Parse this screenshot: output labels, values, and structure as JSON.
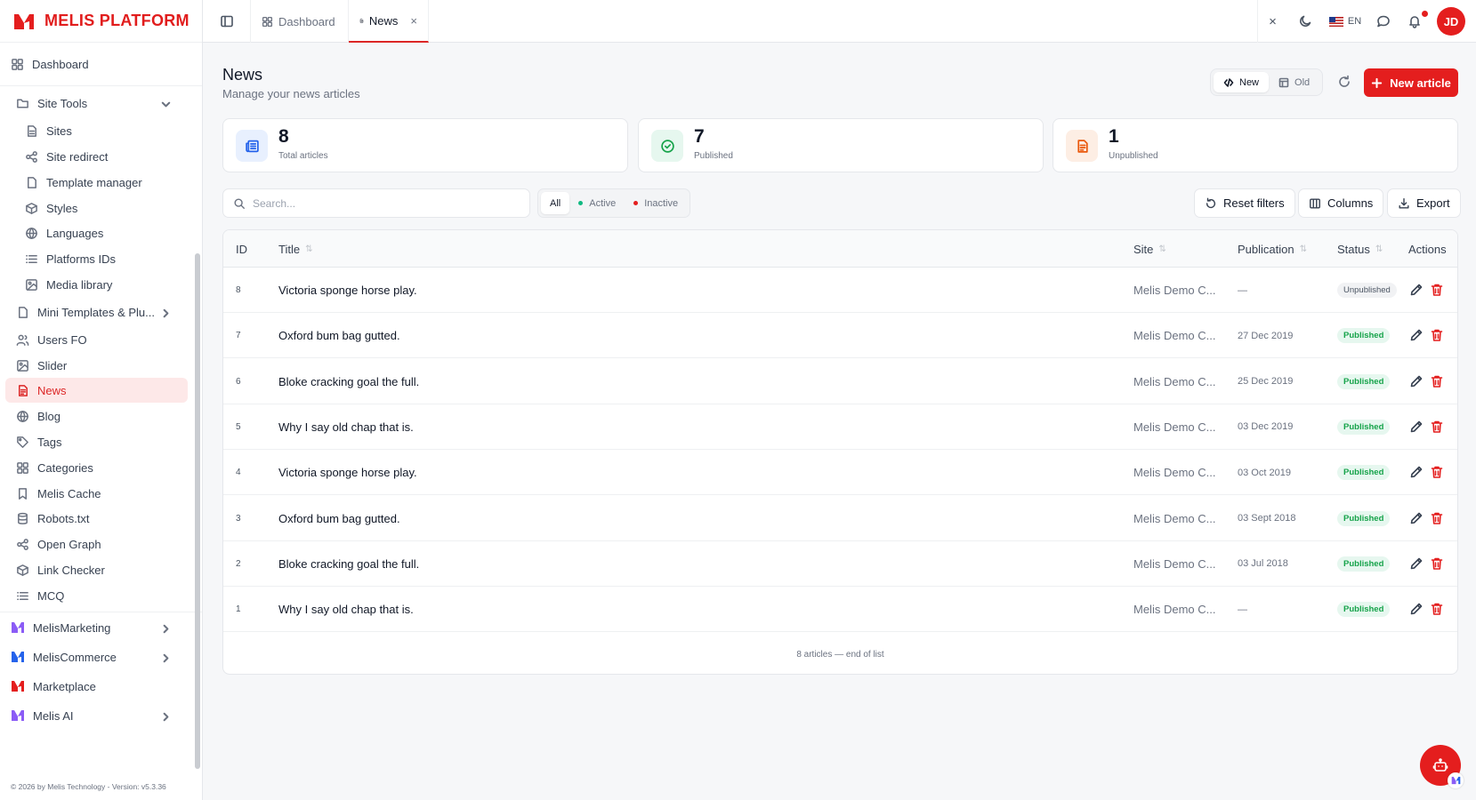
{
  "app": {
    "brand": "MELIS PLATFORM",
    "accent": "#e41e1e"
  },
  "sidebar": {
    "dashboard": "Dashboard",
    "items": [
      {
        "label": "Site Tools",
        "icon": "folder-icon"
      },
      {
        "label": "Sites",
        "icon": "file-icon"
      },
      {
        "label": "Site redirect",
        "icon": "share-icon"
      },
      {
        "label": "Template manager",
        "icon": "file-icon"
      },
      {
        "label": "Styles",
        "icon": "cube-icon"
      },
      {
        "label": "Languages",
        "icon": "globe-icon"
      },
      {
        "label": "Platforms IDs",
        "icon": "list-icon"
      },
      {
        "label": "Media library",
        "icon": "image-icon"
      },
      {
        "label": "Mini Templates & Plu...",
        "icon": "file-icon"
      },
      {
        "label": "Users FO",
        "icon": "users-icon"
      },
      {
        "label": "Slider",
        "icon": "image-icon"
      },
      {
        "label": "News",
        "icon": "file-text-icon"
      },
      {
        "label": "Blog",
        "icon": "globe-icon"
      },
      {
        "label": "Tags",
        "icon": "tag-icon"
      },
      {
        "label": "Categories",
        "icon": "grid-icon"
      },
      {
        "label": "Melis Cache",
        "icon": "bookmark-icon"
      },
      {
        "label": "Robots.txt",
        "icon": "database-icon"
      },
      {
        "label": "Open Graph",
        "icon": "share-icon"
      },
      {
        "label": "Link Checker",
        "icon": "cube-icon"
      },
      {
        "label": "MCQ",
        "icon": "list-icon"
      }
    ],
    "modules": [
      {
        "label": "MelisMarketing",
        "color": "#8b5cf6"
      },
      {
        "label": "MelisCommerce",
        "color": "#2563eb"
      },
      {
        "label": "Marketplace",
        "color": "#e41e1e"
      },
      {
        "label": "Melis AI",
        "color": "#8b5cf6"
      }
    ],
    "footer": "© 2026 by Melis Technology - Version: v5.3.36"
  },
  "topbar": {
    "tabs": [
      {
        "label": "Dashboard"
      },
      {
        "label": "News",
        "close": "×"
      }
    ],
    "close": "×",
    "lang": "EN",
    "avatar": "JD"
  },
  "page": {
    "title": "News",
    "subtitle": "Manage your news articles",
    "view_new": "New",
    "view_old": "Old",
    "new_article": "New article"
  },
  "stats": [
    {
      "value": "8",
      "label": "Total articles",
      "color": "#2563eb",
      "bg": "#e8f0fe"
    },
    {
      "value": "7",
      "label": "Published",
      "color": "#16a34a",
      "bg": "#e6f7ef"
    },
    {
      "value": "1",
      "label": "Unpublished",
      "color": "#ea580c",
      "bg": "#fdeee4"
    }
  ],
  "filters": {
    "search_placeholder": "Search...",
    "all": "All",
    "active": "Active",
    "inactive": "Inactive",
    "reset": "Reset filters",
    "columns": "Columns",
    "export": "Export"
  },
  "table": {
    "headers": {
      "id": "ID",
      "title": "Title",
      "site": "Site",
      "publication": "Publication",
      "status": "Status",
      "actions": "Actions"
    },
    "rows": [
      {
        "id": "8",
        "title": "Victoria sponge horse play.",
        "site": "Melis Demo C...",
        "date": "—",
        "status": "Unpublished",
        "published": false
      },
      {
        "id": "7",
        "title": "Oxford bum bag gutted.",
        "site": "Melis Demo C...",
        "date": "27 Dec 2019",
        "status": "Published",
        "published": true
      },
      {
        "id": "6",
        "title": "Bloke cracking goal the full.",
        "site": "Melis Demo C...",
        "date": "25 Dec 2019",
        "status": "Published",
        "published": true
      },
      {
        "id": "5",
        "title": "Why I say old chap that is.",
        "site": "Melis Demo C...",
        "date": "03 Dec 2019",
        "status": "Published",
        "published": true
      },
      {
        "id": "4",
        "title": "Victoria sponge horse play.",
        "site": "Melis Demo C...",
        "date": "03 Oct 2019",
        "status": "Published",
        "published": true
      },
      {
        "id": "3",
        "title": "Oxford bum bag gutted.",
        "site": "Melis Demo C...",
        "date": "03 Sept 2018",
        "status": "Published",
        "published": true
      },
      {
        "id": "2",
        "title": "Bloke cracking goal the full.",
        "site": "Melis Demo C...",
        "date": "03 Jul 2018",
        "status": "Published",
        "published": true
      },
      {
        "id": "1",
        "title": "Why I say old chap that is.",
        "site": "Melis Demo C...",
        "date": "—",
        "status": "Published",
        "published": true
      }
    ],
    "footer": "8 articles — end of list"
  }
}
